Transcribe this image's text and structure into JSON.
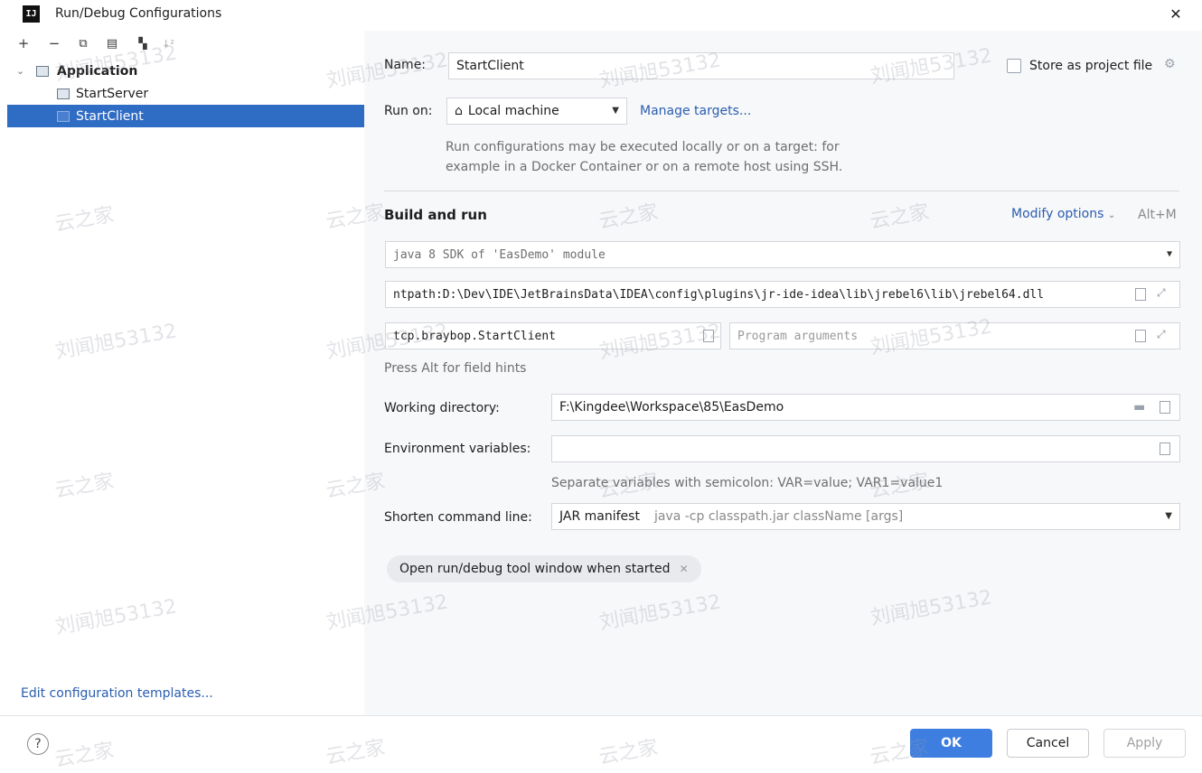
{
  "window": {
    "title": "Run/Debug Configurations",
    "app_icon_text": "IJ"
  },
  "toolbar": {
    "add": "+",
    "remove": "−",
    "copy": "⧉",
    "save": "▤",
    "move": "▚",
    "sort": "↓²"
  },
  "tree": {
    "group_label": "Application",
    "items": [
      {
        "label": "StartServer"
      },
      {
        "label": "StartClient"
      }
    ]
  },
  "edit_templates_link": "Edit configuration templates...",
  "form": {
    "name_label": "Name:",
    "name_value": "StartClient",
    "store_label": "Store as project file",
    "run_on_label": "Run on:",
    "run_on_value": "Local machine",
    "manage_targets": "Manage targets...",
    "run_on_hint_line1": "Run configurations may be executed locally or on a target: for",
    "run_on_hint_line2": "example in a Docker Container or on a remote host using SSH.",
    "build_run_title": "Build and run",
    "modify_options": "Modify options",
    "modify_shortcut": "Alt+M",
    "jdk_value": "java 8 SDK of 'EasDemo' module",
    "vm_options_value": "ntpath:D:\\Dev\\IDE\\JetBrainsData\\IDEA\\config\\plugins\\jr-ide-idea\\lib\\jrebel6\\lib\\jrebel64.dll",
    "main_class_value": "tcp.braybop.StartClient",
    "program_args_placeholder": "Program arguments",
    "field_hint": "Press Alt for field hints",
    "working_dir_label": "Working directory:",
    "working_dir_value": "F:\\Kingdee\\Workspace\\85\\EasDemo",
    "env_label": "Environment variables:",
    "env_value": "",
    "env_hint": "Separate variables with semicolon: VAR=value; VAR1=value1",
    "shorten_label": "Shorten command line:",
    "shorten_value": "JAR manifest",
    "shorten_detail": "java -cp classpath.jar className [args]",
    "chip_label": "Open run/debug tool window when started"
  },
  "buttons": {
    "help": "?",
    "ok": "OK",
    "cancel": "Cancel",
    "apply": "Apply"
  },
  "watermarks": {
    "text_a": "刘闻旭53132",
    "text_b": "云之家"
  }
}
